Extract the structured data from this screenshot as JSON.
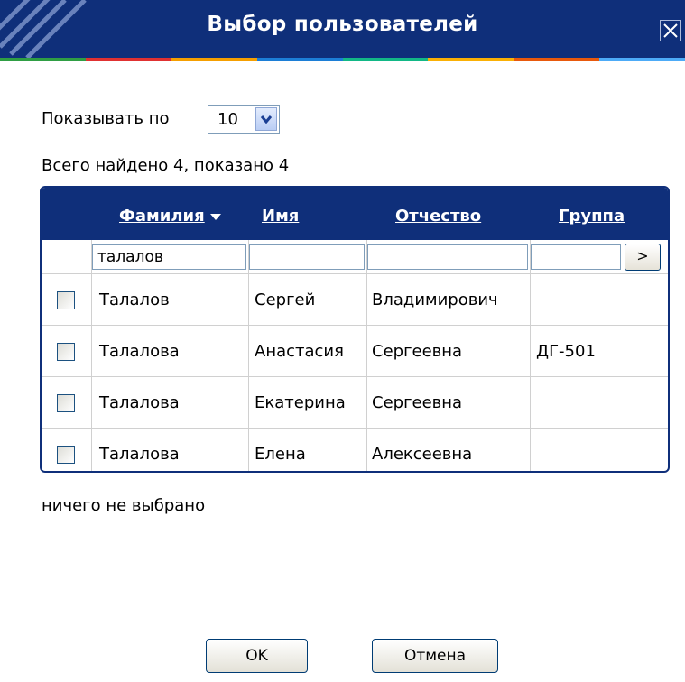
{
  "dialog": {
    "title": "Выбор пользователей",
    "close_label": "X",
    "accent_colors": [
      "#2f9e44",
      "#e03131",
      "#f59f00",
      "#1c7ed6",
      "#12b886",
      "#fab005",
      "#e8590c",
      "#4dabf7"
    ]
  },
  "pagination": {
    "show_label": "Показывать по",
    "page_size": "10",
    "found_text": "Всего найдено 4, показано 4"
  },
  "table": {
    "columns": [
      {
        "label": "Фамилия",
        "sorted": "desc"
      },
      {
        "label": "Имя"
      },
      {
        "label": "Отчество"
      },
      {
        "label": "Группа"
      }
    ],
    "filters": {
      "surname": "талалов",
      "name": "",
      "patronymic": "",
      "group": ""
    },
    "apply_filter_label": ">",
    "rows": [
      {
        "surname": "Талалов",
        "name": "Сергей",
        "patronymic": "Владимирович",
        "group": "",
        "checked": false
      },
      {
        "surname": "Талалова",
        "name": "Анастасия",
        "patronymic": "Сергеевна",
        "group": "ДГ-501",
        "checked": false
      },
      {
        "surname": "Талалова",
        "name": "Екатерина",
        "patronymic": "Сергеевна",
        "group": "",
        "checked": false
      },
      {
        "surname": "Талалова",
        "name": "Елена",
        "patronymic": "Алексеевна",
        "group": "",
        "checked": false
      }
    ]
  },
  "selection_status": "ничего не выбрано",
  "buttons": {
    "ok": "OK",
    "cancel": "Отмена"
  }
}
